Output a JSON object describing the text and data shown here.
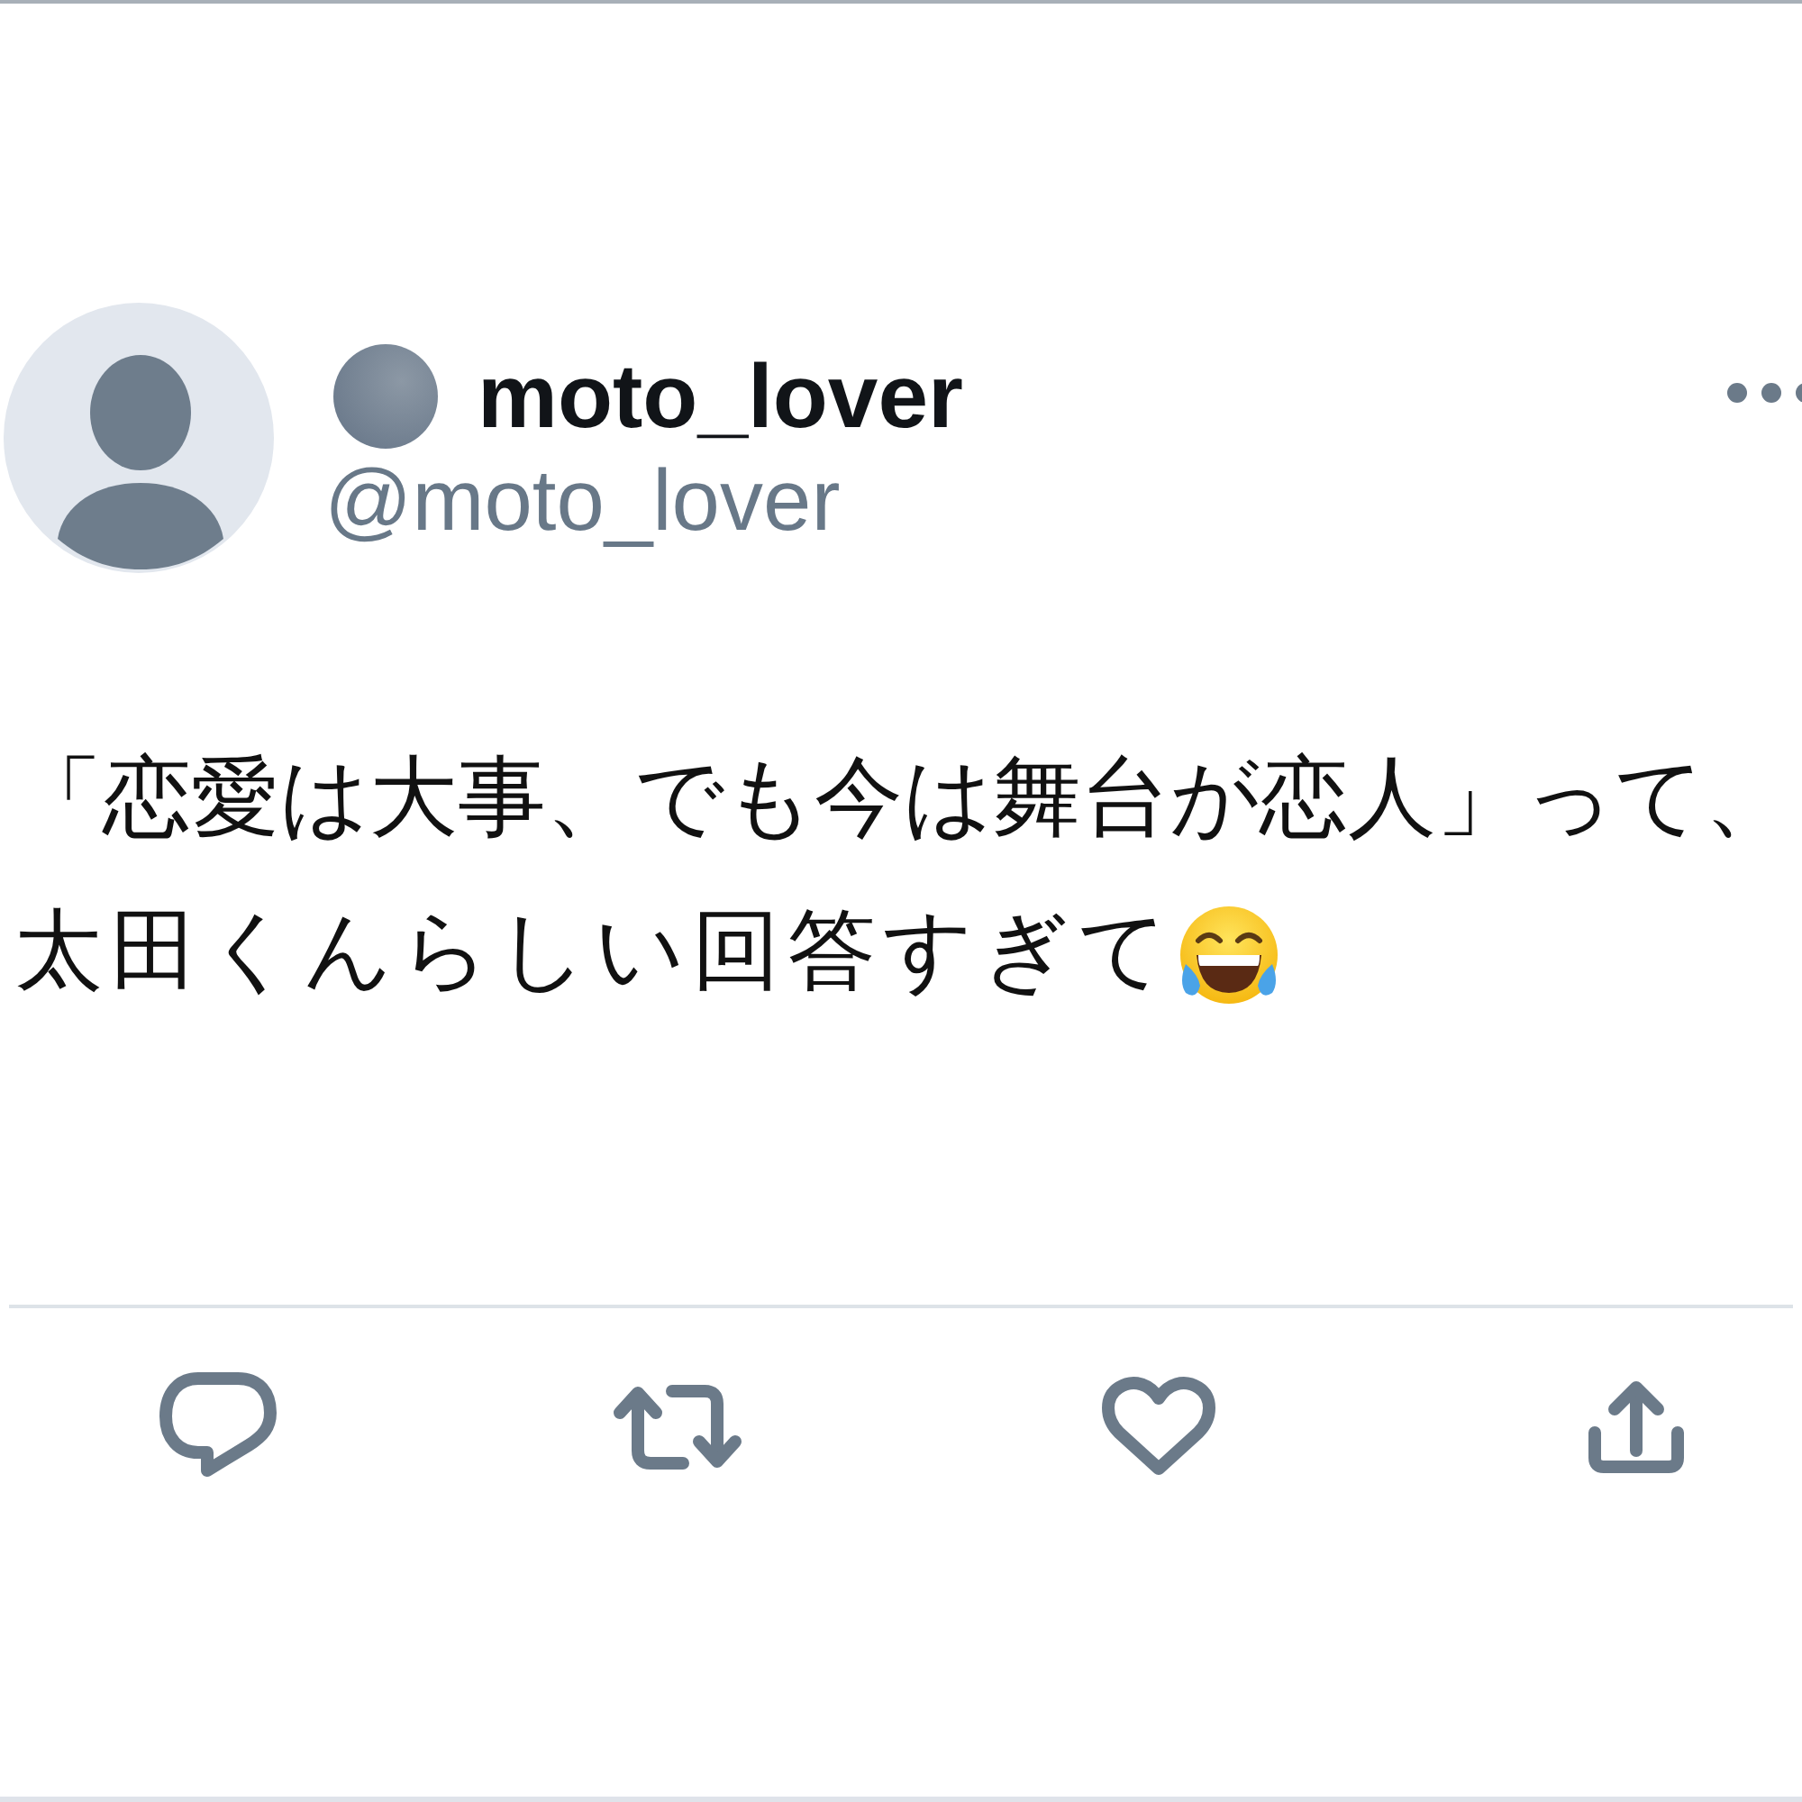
{
  "tweet": {
    "author": {
      "display_name": "moto_lover",
      "handle": "@moto_lover"
    },
    "text_lines": [
      "「恋愛は大事、でも今は舞台が恋人」って、",
      "太田くんらしい回答すぎて"
    ]
  }
}
